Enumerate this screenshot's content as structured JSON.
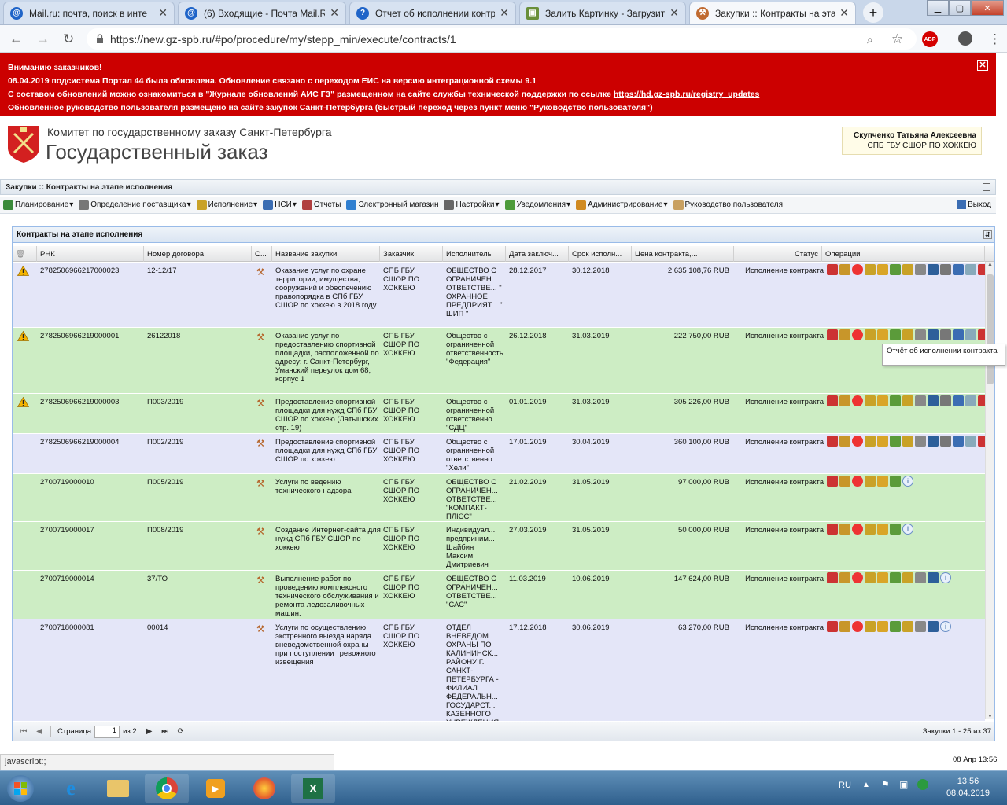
{
  "browser": {
    "tabs": [
      {
        "title": "Mail.ru: почта, поиск в инте",
        "icon": "mail-icon",
        "active": false
      },
      {
        "title": "(6) Входящие - Почта Mail.R",
        "icon": "mail-icon",
        "active": false
      },
      {
        "title": "Отчет об исполнении контр",
        "icon": "globe-icon",
        "active": false
      },
      {
        "title": "Залить Картинку - Загрузит",
        "icon": "image-icon",
        "active": false
      },
      {
        "title": "Закупки :: Контракты на эта",
        "icon": "gavel-icon",
        "active": true
      }
    ],
    "new_tab": "+",
    "url": "https://new.gz-spb.ru/#po/procedure/my/stepp_min/execute/contracts/1",
    "adblock": "ABP"
  },
  "banner": {
    "line1": "Вниманию заказчиков!",
    "line2": "08.04.2019 подсистема Портал 44 была обновлена. Обновление связано с переходом ЕИС на версию интеграционной схемы 9.1",
    "line3_prefix": "С составом обновлений можно ознакомиться в \"Журнале обновлений АИС ГЗ\" размещенном на сайте службы технической поддержки по ссылке ",
    "line3_link": "https://hd.gz-spb.ru/registry_updates",
    "line4": "Обновленное руководство пользователя размещено на сайте закупок Санкт-Петербурга (быстрый переход через пункт меню \"Руководство пользователя\")",
    "close": "✕"
  },
  "header": {
    "org_line1": "Комитет по государственному заказу Санкт-Петербурга",
    "org_line2": "Государственный заказ",
    "user_name": "Скупченко Татьяна Алексеевна",
    "user_org": "СПБ ГБУ СШОР ПО ХОККЕЮ"
  },
  "panel_title": "Закупки :: Контракты на этапе исполнения",
  "menu": [
    {
      "label": "Планирование",
      "dropdown": true,
      "color": "#3a8a3a"
    },
    {
      "label": "Определение поставщика",
      "dropdown": true,
      "color": "#777"
    },
    {
      "label": "Исполнение",
      "dropdown": true,
      "color": "#c9a227"
    },
    {
      "label": "НСИ",
      "dropdown": true,
      "color": "#3b6db3"
    },
    {
      "label": "Отчеты",
      "dropdown": false,
      "color": "#b04040"
    },
    {
      "label": "Электронный магазин",
      "dropdown": false,
      "color": "#2f7fd0"
    },
    {
      "label": "Настройки",
      "dropdown": true,
      "color": "#666"
    },
    {
      "label": "Уведомления",
      "dropdown": true,
      "color": "#4d9b3a"
    },
    {
      "label": "Администрирование",
      "dropdown": true,
      "color": "#d08a20"
    },
    {
      "label": "Руководство пользователя",
      "dropdown": false,
      "color": "#c8a060"
    }
  ],
  "exit_label": "Выход",
  "grid": {
    "title": "Контракты на этапе исполнения",
    "columns": [
      "",
      "РНК",
      "Номер договора",
      "С...",
      "Название закупки",
      "Заказчик",
      "Исполнитель",
      "Дата заключ...",
      "Срок исполн...",
      "Цена контракта,...",
      "Статус",
      "Операции"
    ],
    "rows": [
      {
        "warn": true,
        "rnk": "2782506966217000023",
        "num": "12-12/17",
        "name": "Оказание услуг по охране территории, имущества, сооружений и обеспечению правопорядка в СПб ГБУ СШОР по хоккею в 2018 году",
        "customer": "СПБ ГБУ СШОР ПО ХОККЕЮ",
        "executor": "ОБЩЕСТВО С ОГРАНИЧЕН... ОТВЕТСТВЕ... \" ОХРАННОЕ ПРЕДПРИЯТ... \" ШИП \"",
        "date": "28.12.2017",
        "term": "30.12.2018",
        "price": "2 635 108,76 RUB",
        "status": "Исполнение контракта",
        "ops": 14
      },
      {
        "warn": true,
        "rnk": "2782506966219000001",
        "num": "26122018",
        "name": "Оказание услуг по предоставлению спортивной площадки, расположенной по адресу: г. Санкт-Петербург, Уманский переулок дом 68, корпус 1",
        "customer": "СПБ ГБУ СШОР ПО ХОККЕЮ",
        "executor": "Общество с ограниченной ответственностью \"Федерация\"",
        "date": "26.12.2018",
        "term": "31.03.2019",
        "price": "222 750,00 RUB",
        "status": "Исполнение контракта",
        "ops": 14
      },
      {
        "warn": true,
        "rnk": "2782506966219000003",
        "num": "П003/2019",
        "name": "Предоставление спортивной площадки для нужд СПб ГБУ СШОР по хоккею (Латышских стр. 19)",
        "customer": "СПБ ГБУ СШОР ПО ХОККЕЮ",
        "executor": "Общество с ограниченной ответственно... \"СДЦ\"",
        "date": "01.01.2019",
        "term": "31.03.2019",
        "price": "305 226,00 RUB",
        "status": "Исполнение контракта",
        "ops": 14
      },
      {
        "warn": false,
        "rnk": "2782506966219000004",
        "num": "П002/2019",
        "name": "Предоставление спортивной площадки для нужд СПб ГБУ СШОР по хоккею",
        "customer": "СПБ ГБУ СШОР ПО ХОККЕЮ",
        "executor": "Общество с ограниченной ответственно... \"Хели\"",
        "date": "17.01.2019",
        "term": "30.04.2019",
        "price": "360 100,00 RUB",
        "status": "Исполнение контракта",
        "ops": 14
      },
      {
        "warn": false,
        "rnk": "2700719000010",
        "num": "П005/2019",
        "name": "Услуги по ведению технического надзора",
        "customer": "СПБ ГБУ СШОР ПО ХОККЕЮ",
        "executor": "ОБЩЕСТВО С ОГРАНИЧЕН... ОТВЕТСТВЕ... \"КОМПАКТ-ПЛЮС\"",
        "date": "21.02.2019",
        "term": "31.05.2019",
        "price": "97 000,00 RUB",
        "status": "Исполнение контракта",
        "ops": 6
      },
      {
        "warn": false,
        "rnk": "2700719000017",
        "num": "П008/2019",
        "name": "Создание Интернет-сайта для нужд СПб ГБУ СШОР по хоккею",
        "customer": "СПБ ГБУ СШОР ПО ХОККЕЮ",
        "executor": "Индивидуал... предприним... Шайбин Максим Дмитриевич",
        "date": "27.03.2019",
        "term": "31.05.2019",
        "price": "50 000,00 RUB",
        "status": "Исполнение контракта",
        "ops": 6
      },
      {
        "warn": false,
        "rnk": "2700719000014",
        "num": "37/ТО",
        "name": "Выполнение работ по проведению комплексного технического обслуживания и ремонта ледозаливочных машин.",
        "customer": "СПБ ГБУ СШОР ПО ХОККЕЮ",
        "executor": "ОБЩЕСТВО С ОГРАНИЧЕН... ОТВЕТСТВЕ... \"САС\"",
        "date": "11.03.2019",
        "term": "10.06.2019",
        "price": "147 624,00 RUB",
        "status": "Исполнение контракта",
        "ops": 9
      },
      {
        "warn": false,
        "rnk": "2700718000081",
        "num": "00014",
        "name": "Услуги по осуществлению экстренного выезда наряда вневедомственной охраны при поступлении тревожного извещения",
        "customer": "СПБ ГБУ СШОР ПО ХОККЕЮ",
        "executor": "ОТДЕЛ ВНЕВЕДОМ... ОХРАНЫ ПО КАЛИНИНСК... РАЙОНУ Г. САНКТ-ПЕТЕРБУРГА - ФИЛИАЛ ФЕДЕРАЛЬН... ГОСУДАРСТ... КАЗЕННОГО УЧРЕЖДЕНИЯ",
        "date": "17.12.2018",
        "term": "30.06.2019",
        "price": "63 270,00 RUB",
        "status": "Исполнение контракта",
        "ops": 9
      }
    ],
    "tooltip": "Отчёт об исполнении контракта",
    "pager": {
      "page_label": "Страница",
      "page": "1",
      "of": "из 2",
      "records": "Закупки 1 - 25 из 37"
    }
  },
  "statusbar": "javascript:;",
  "page_date": "08 Апр 13:56",
  "taskbar": {
    "lang": "RU",
    "time": "13:56",
    "date": "08.04.2019",
    "apps": [
      "start",
      "internet-explorer",
      "file-explorer",
      "chrome",
      "media-player",
      "firefox",
      "excel"
    ]
  }
}
